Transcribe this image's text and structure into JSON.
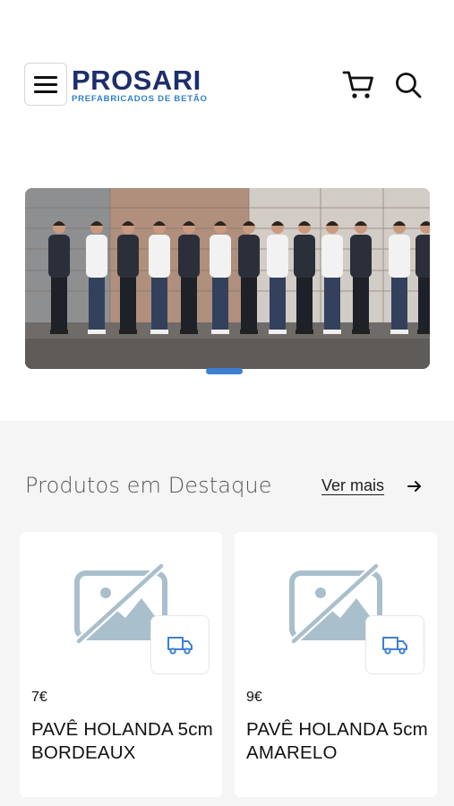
{
  "header": {
    "menu_icon": "hamburger-menu-icon",
    "logo": {
      "word": "PROSARI",
      "tagline": "PREFABRICADOS DE BETÃO"
    },
    "cart_icon": "cart-icon",
    "search_icon": "search-icon"
  },
  "hero": {
    "slides": 1,
    "active_slide": 1
  },
  "featured": {
    "title": "Produtos em Destaque",
    "see_more_label": "Ver mais",
    "arrow_icon": "arrow-right-icon",
    "products": [
      {
        "price": "7€",
        "name": "PAVÊ HOLANDA 5cm BORDEAUX",
        "image_icon": "image-placeholder-icon",
        "badge_icon": "delivery-truck-icon"
      },
      {
        "price": "9€",
        "name": "PAVÊ HOLANDA 5cm AMARELO",
        "image_icon": "image-placeholder-icon",
        "badge_icon": "delivery-truck-icon"
      }
    ]
  },
  "colors": {
    "brand_navy": "#1e2e6b",
    "brand_blue": "#2e7fc4",
    "accent": "#3d7fd3",
    "section_bg": "#f5f5f5",
    "placeholder": "#a9bfcc"
  }
}
